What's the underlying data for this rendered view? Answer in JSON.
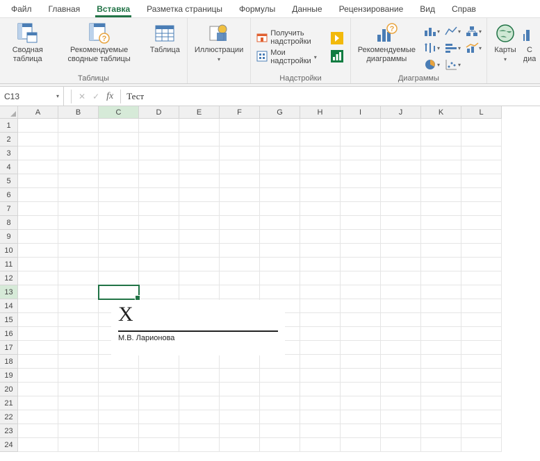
{
  "menu": {
    "tabs": [
      "Файл",
      "Главная",
      "Вставка",
      "Разметка страницы",
      "Формулы",
      "Данные",
      "Рецензирование",
      "Вид",
      "Справ"
    ],
    "active_index": 2
  },
  "ribbon": {
    "tables": {
      "label": "Таблицы",
      "pivot": "Сводная\nтаблица",
      "recommended": "Рекомендуемые\nсводные таблицы",
      "table": "Таблица"
    },
    "illustrations": {
      "label": "Иллюстрации"
    },
    "addins": {
      "group_label": "Надстройки",
      "get": "Получить надстройки",
      "my": "Мои надстройки"
    },
    "charts": {
      "group_label": "Диаграммы",
      "recommended": "Рекомендуемые\nдиаграммы"
    },
    "maps": {
      "label": "Карты"
    },
    "sparklines_partial": "С\nдиа"
  },
  "formula_bar": {
    "name_box": "C13",
    "value": "Тест"
  },
  "grid": {
    "columns": [
      "A",
      "B",
      "C",
      "D",
      "E",
      "F",
      "G",
      "H",
      "I",
      "J",
      "K",
      "L"
    ],
    "rows": [
      1,
      2,
      3,
      4,
      5,
      6,
      7,
      8,
      9,
      10,
      11,
      12,
      13,
      14,
      15,
      16,
      17,
      18,
      19,
      20,
      21,
      22,
      23,
      24
    ],
    "selected": {
      "col": "C",
      "row": 13
    }
  },
  "signature": {
    "placeholder_mark": "X",
    "name": "М.В. Ларионова"
  }
}
